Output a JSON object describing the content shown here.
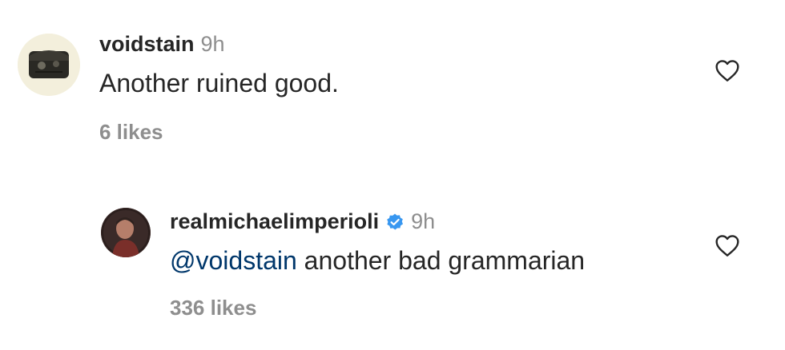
{
  "comments": [
    {
      "username": "voidstain",
      "timestamp": "9h",
      "text": "Another ruined good.",
      "likes": "6 likes"
    },
    {
      "username": "realmichaelimperioli",
      "verified": true,
      "timestamp": "9h",
      "mention": "@voidstain",
      "text": " another bad grammarian",
      "likes": "336 likes"
    }
  ],
  "icons": {
    "like": "heart-outline-icon",
    "verified": "verified-badge-icon"
  },
  "colors": {
    "text": "#262626",
    "muted": "#8e8e8e",
    "mention": "#00376b",
    "verified": "#3897f0"
  }
}
